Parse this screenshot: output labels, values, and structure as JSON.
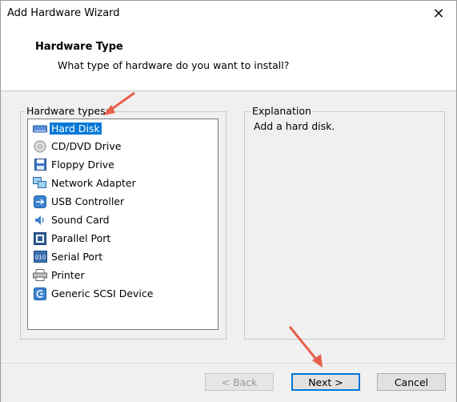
{
  "window": {
    "title": "Add Hardware Wizard",
    "close_glyph": "✕"
  },
  "header": {
    "title": "Hardware Type",
    "subtitle": "What type of hardware do you want to install?"
  },
  "list": {
    "label": "Hardware types:",
    "items": [
      {
        "label": "Hard Disk",
        "icon": "hard-disk-icon",
        "selected": true
      },
      {
        "label": "CD/DVD Drive",
        "icon": "cd-dvd-icon"
      },
      {
        "label": "Floppy Drive",
        "icon": "floppy-icon"
      },
      {
        "label": "Network Adapter",
        "icon": "network-adapter-icon"
      },
      {
        "label": "USB Controller",
        "icon": "usb-icon"
      },
      {
        "label": "Sound Card",
        "icon": "sound-card-icon"
      },
      {
        "label": "Parallel Port",
        "icon": "parallel-port-icon"
      },
      {
        "label": "Serial Port",
        "icon": "serial-port-icon"
      },
      {
        "label": "Printer",
        "icon": "printer-icon"
      },
      {
        "label": "Generic SCSI Device",
        "icon": "scsi-device-icon"
      }
    ]
  },
  "explanation": {
    "label": "Explanation",
    "text": "Add a hard disk."
  },
  "footer": {
    "back": "< Back",
    "next": "Next >",
    "cancel": "Cancel"
  },
  "colors": {
    "selection": "#0078d7",
    "annotation_arrow": "#e8604c"
  }
}
